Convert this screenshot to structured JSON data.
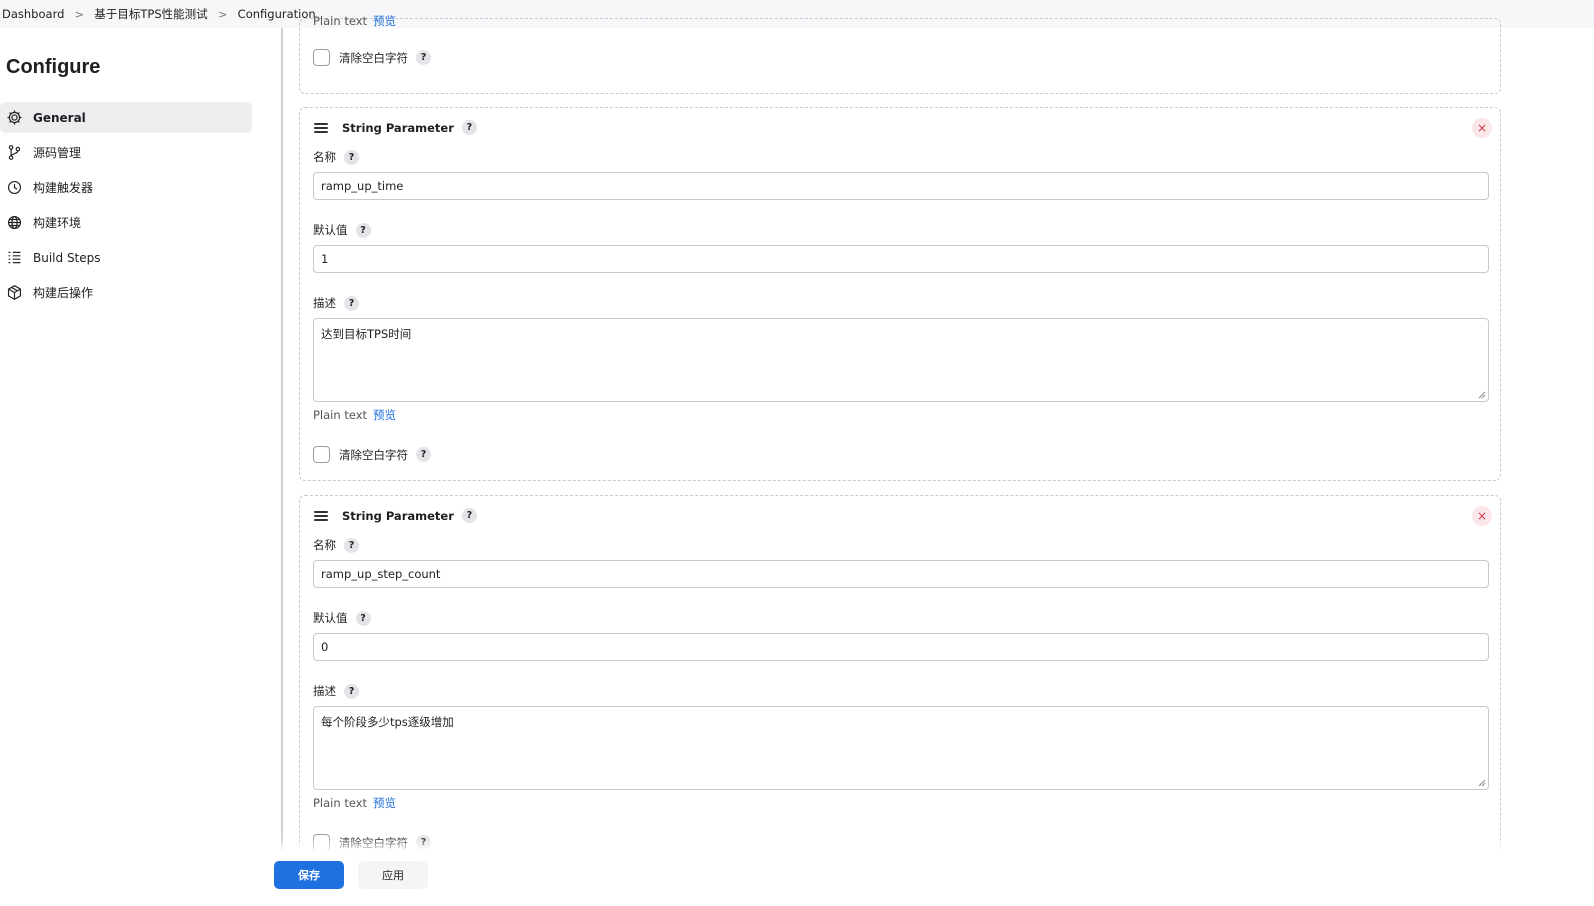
{
  "breadcrumb": {
    "items": [
      "Dashboard",
      "基于目标TPS性能测试",
      "Configuration"
    ],
    "separator": ">"
  },
  "sidebar": {
    "title": "Configure",
    "items": [
      {
        "label": "General",
        "icon": "gear-icon",
        "active": true
      },
      {
        "label": "源码管理",
        "icon": "branch-icon"
      },
      {
        "label": "构建触发器",
        "icon": "clock-icon"
      },
      {
        "label": "构建环境",
        "icon": "globe-icon"
      },
      {
        "label": "Build Steps",
        "icon": "list-icon"
      },
      {
        "label": "构建后操作",
        "icon": "cube-icon"
      }
    ]
  },
  "top_partial_card": {
    "format_label": "Plain text",
    "preview_link": "预览",
    "trim_label": "清除空白字符"
  },
  "params": [
    {
      "type_label": "String Parameter",
      "name_label": "名称",
      "name_value": "ramp_up_time",
      "default_label": "默认值",
      "default_value": "1",
      "desc_label": "描述",
      "desc_value": "达到目标TPS时间",
      "format_label": "Plain text",
      "preview_link": "预览",
      "trim_label": "清除空白字符"
    },
    {
      "type_label": "String Parameter",
      "name_label": "名称",
      "name_value": "ramp_up_step_count",
      "default_label": "默认值",
      "default_value": "0",
      "desc_label": "描述",
      "desc_value": "每个阶段多少tps逐级增加",
      "format_label": "Plain text",
      "preview_link": "预览",
      "trim_label": "清除空白字符"
    }
  ],
  "help_glyph": "?",
  "close_glyph": "×",
  "footer": {
    "save_label": "保存",
    "apply_label": "应用"
  },
  "colors": {
    "primary": "#1f71e0",
    "danger": "#d3384b",
    "link": "#1a6fdb"
  }
}
